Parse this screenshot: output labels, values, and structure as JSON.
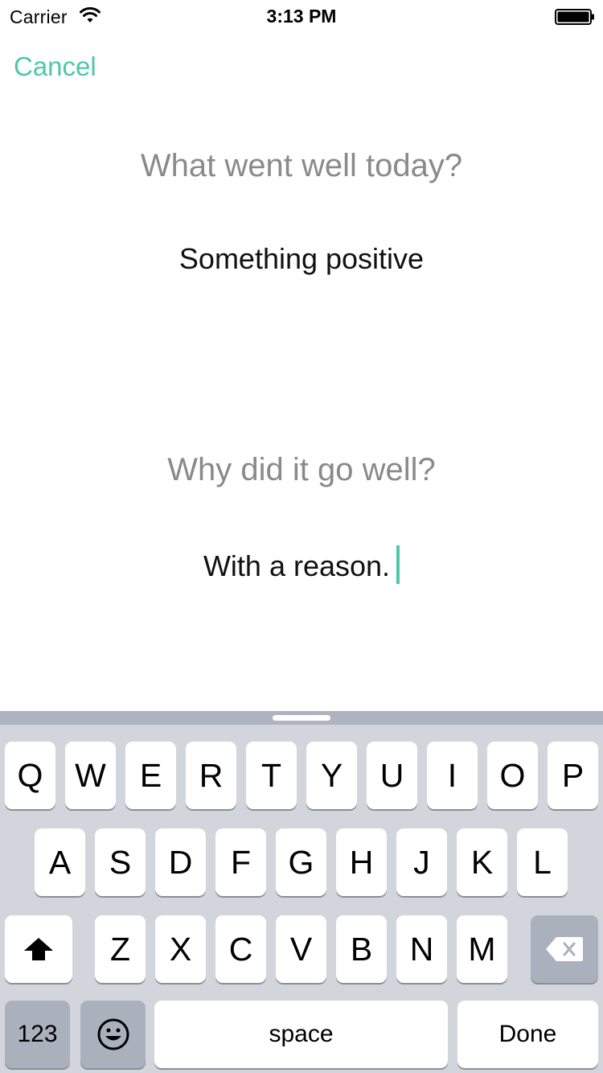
{
  "status_bar": {
    "carrier": "Carrier",
    "time": "3:13 PM",
    "wifi_icon": "wifi-icon",
    "battery_icon": "battery-icon"
  },
  "nav": {
    "cancel_label": "Cancel",
    "accent_color": "#4fc7ab"
  },
  "content": {
    "question_1": "What went well today?",
    "answer_1": "Something positive",
    "question_2": "Why did it go well?",
    "answer_2": "With a reason."
  },
  "keyboard": {
    "row1": [
      "Q",
      "W",
      "E",
      "R",
      "T",
      "Y",
      "U",
      "I",
      "O",
      "P"
    ],
    "row2": [
      "A",
      "S",
      "D",
      "F",
      "G",
      "H",
      "J",
      "K",
      "L"
    ],
    "row3": [
      "Z",
      "X",
      "C",
      "V",
      "B",
      "N",
      "M"
    ],
    "numbers_label": "123",
    "space_label": "space",
    "done_label": "Done",
    "shift_icon": "shift-icon",
    "delete_icon": "delete-icon",
    "emoji_icon": "emoji-icon"
  }
}
